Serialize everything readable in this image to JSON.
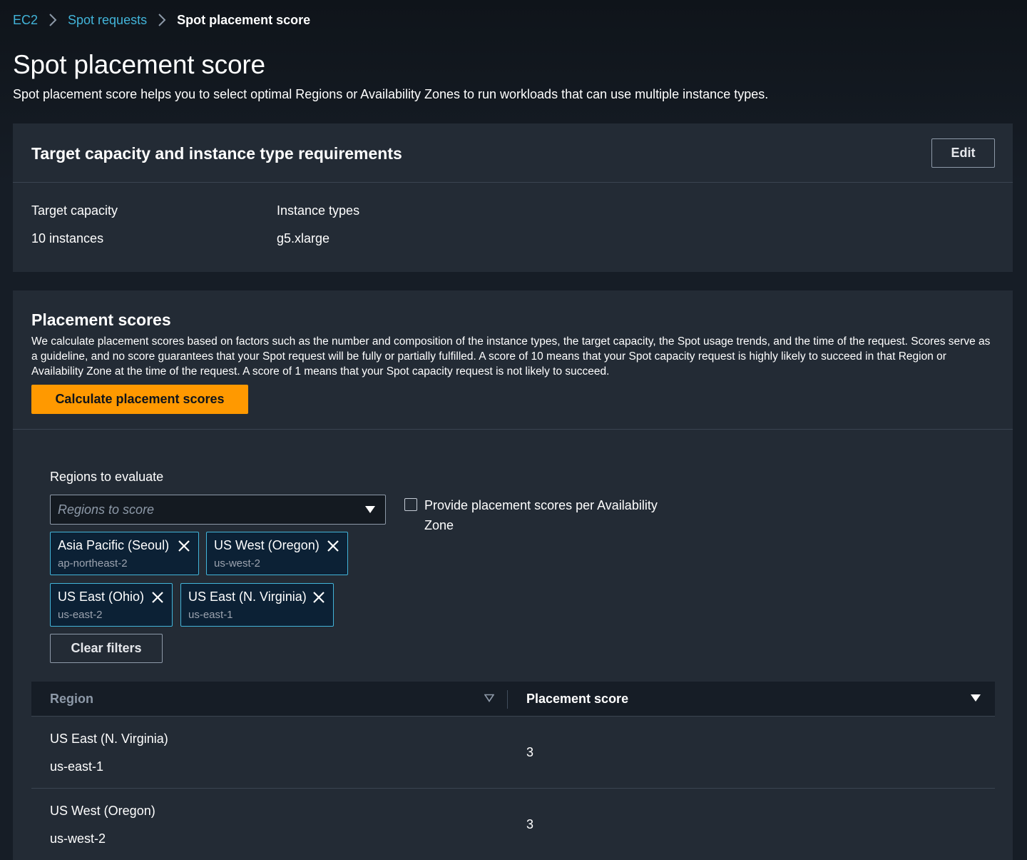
{
  "breadcrumb": {
    "items": [
      "EC2",
      "Spot requests"
    ],
    "current": "Spot placement score"
  },
  "page": {
    "title": "Spot placement score",
    "description": "Spot placement score helps you to select optimal Regions or Availability Zones to run workloads that can use multiple instance types."
  },
  "requirements": {
    "title": "Target capacity and instance type requirements",
    "edit_label": "Edit",
    "target_capacity_label": "Target capacity",
    "target_capacity_value": "10 instances",
    "instance_types_label": "Instance types",
    "instance_types_value": "g5.xlarge"
  },
  "scores": {
    "title": "Placement scores",
    "description": "We calculate placement scores based on factors such as the number and composition of the instance types, the target capacity, the Spot usage trends, and the time of the request. Scores serve as a guideline, and no score guarantees that your Spot request will be fully or partially fulfilled. A score of 10 means that your Spot capacity request is highly likely to succeed in that Region or Availability Zone at the time of the request. A score of 1 means that your Spot capacity request is not likely to succeed.",
    "calculate_label": "Calculate placement scores",
    "regions_label": "Regions to evaluate",
    "regions_placeholder": "Regions to score",
    "az_checkbox_label": "Provide placement scores per Availability Zone",
    "az_checked": false,
    "tokens": [
      {
        "name": "Asia Pacific (Seoul)",
        "code": "ap-northeast-2"
      },
      {
        "name": "US West (Oregon)",
        "code": "us-west-2"
      },
      {
        "name": "US East (Ohio)",
        "code": "us-east-2"
      },
      {
        "name": "US East (N. Virginia)",
        "code": "us-east-1"
      }
    ],
    "clear_label": "Clear filters"
  },
  "table": {
    "columns": [
      "Region",
      "Placement score"
    ],
    "rows": [
      {
        "name": "US East (N. Virginia)",
        "code": "us-east-1",
        "score": "3"
      },
      {
        "name": "US West (Oregon)",
        "code": "us-west-2",
        "score": "3"
      }
    ]
  },
  "colors": {
    "background": "#161d26",
    "panel": "#232b35",
    "link": "#42b4d9",
    "primary_button": "#ff9900",
    "token_border": "#42b4d9"
  }
}
